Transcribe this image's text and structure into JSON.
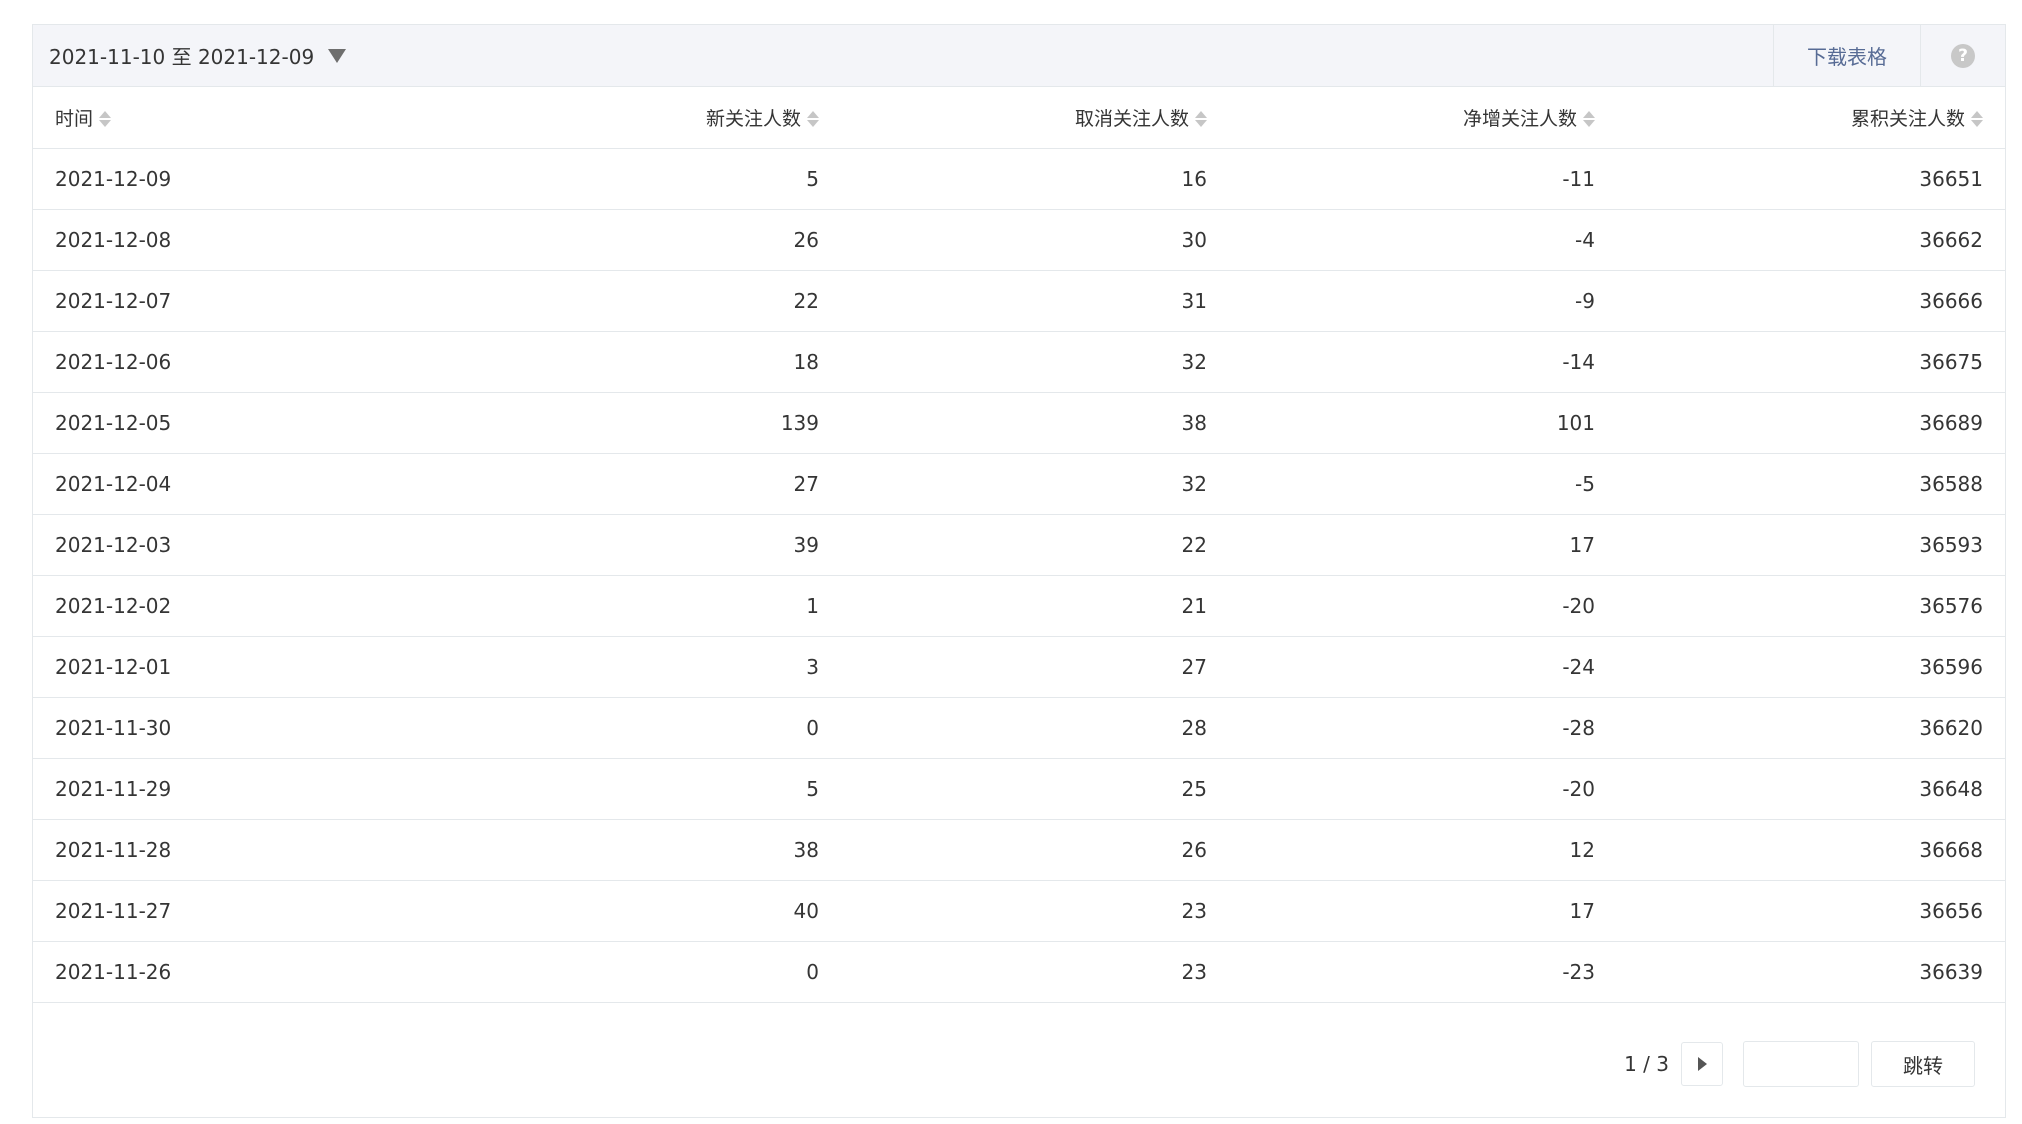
{
  "toolbar": {
    "date_range": "2021-11-10 至 2021-12-09",
    "download_label": "下载表格",
    "help_symbol": "?"
  },
  "table": {
    "headers": [
      "时间",
      "新关注人数",
      "取消关注人数",
      "净增关注人数",
      "累积关注人数"
    ],
    "rows": [
      [
        "2021-12-09",
        "5",
        "16",
        "-11",
        "36651"
      ],
      [
        "2021-12-08",
        "26",
        "30",
        "-4",
        "36662"
      ],
      [
        "2021-12-07",
        "22",
        "31",
        "-9",
        "36666"
      ],
      [
        "2021-12-06",
        "18",
        "32",
        "-14",
        "36675"
      ],
      [
        "2021-12-05",
        "139",
        "38",
        "101",
        "36689"
      ],
      [
        "2021-12-04",
        "27",
        "32",
        "-5",
        "36588"
      ],
      [
        "2021-12-03",
        "39",
        "22",
        "17",
        "36593"
      ],
      [
        "2021-12-02",
        "1",
        "21",
        "-20",
        "36576"
      ],
      [
        "2021-12-01",
        "3",
        "27",
        "-24",
        "36596"
      ],
      [
        "2021-11-30",
        "0",
        "28",
        "-28",
        "36620"
      ],
      [
        "2021-11-29",
        "5",
        "25",
        "-20",
        "36648"
      ],
      [
        "2021-11-28",
        "38",
        "26",
        "12",
        "36668"
      ],
      [
        "2021-11-27",
        "40",
        "23",
        "17",
        "36656"
      ],
      [
        "2021-11-26",
        "0",
        "23",
        "-23",
        "36639"
      ]
    ]
  },
  "pager": {
    "page_info": "1 / 3",
    "jump_input_value": "",
    "jump_label": "跳转"
  },
  "colors": {
    "link": "#576b95",
    "border": "#e4e8eb",
    "toolbar_bg": "#f4f5f9"
  }
}
